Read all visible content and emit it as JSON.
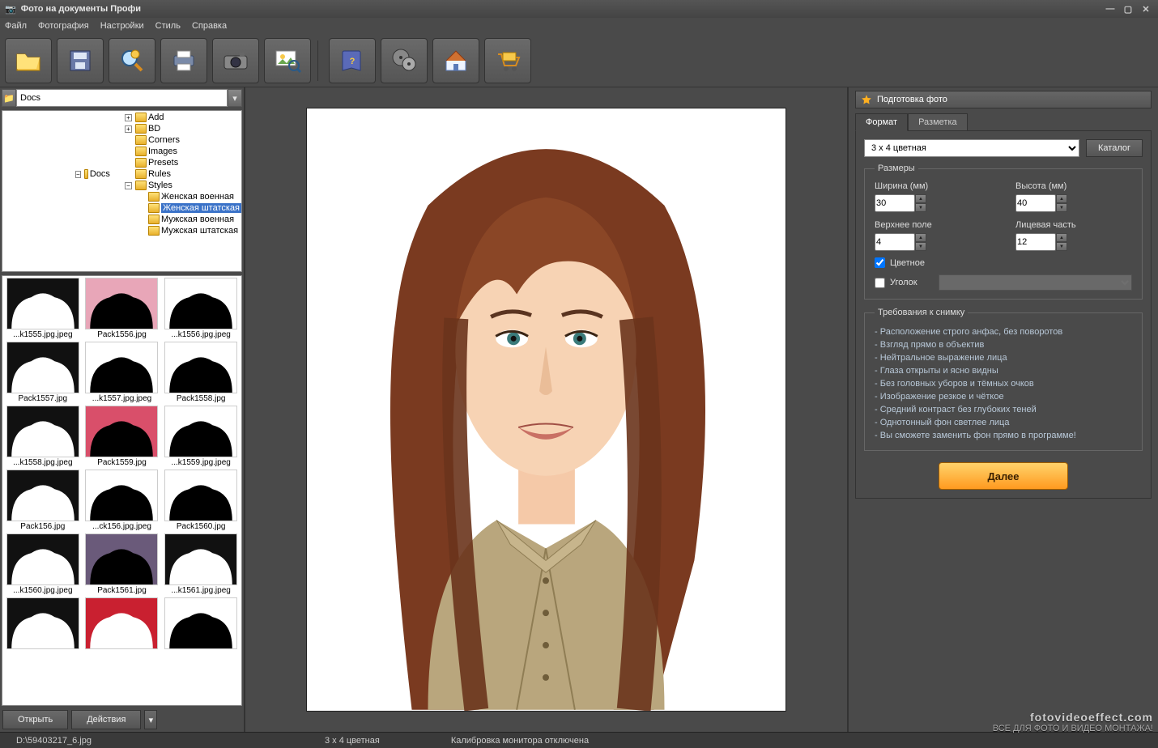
{
  "window": {
    "title": "Фото на документы Профи"
  },
  "menu": {
    "file": "Файл",
    "photo": "Фотография",
    "settings": "Настройки",
    "style": "Стиль",
    "help": "Справка"
  },
  "toolbar_icons": [
    "open",
    "save",
    "zoom",
    "print",
    "camera",
    "pictureview",
    "sep",
    "book",
    "film",
    "home",
    "cart"
  ],
  "path": {
    "value": "Docs"
  },
  "tree": {
    "root": "Docs",
    "items": [
      "Add",
      "BD",
      "Corners",
      "Images",
      "Presets",
      "Rules",
      "Styles"
    ],
    "styles_children": [
      "Женская военная",
      "Женская штатская",
      "Мужская военная",
      "Мужская штатская"
    ],
    "selected": "Женская штатская"
  },
  "thumbs": [
    "...k1555.jpg.jpeg",
    "Pack1556.jpg",
    "...k1556.jpg.jpeg",
    "Pack1557.jpg",
    "...k1557.jpg.jpeg",
    "Pack1558.jpg",
    "...k1558.jpg.jpeg",
    "Pack1559.jpg",
    "...k1559.jpg.jpeg",
    "Pack156.jpg",
    "...ck156.jpg.jpeg",
    "Pack1560.jpg",
    "...k1560.jpg.jpeg",
    "Pack1561.jpg",
    "...k1561.jpg.jpeg",
    "",
    "",
    ""
  ],
  "left_buttons": {
    "open": "Открыть",
    "actions": "Действия"
  },
  "right": {
    "title": "Подготовка фото",
    "tabs": {
      "format": "Формат",
      "layout": "Разметка"
    },
    "format_select": "3 x 4 цветная",
    "catalog": "Каталог",
    "sizes_legend": "Размеры",
    "width_label": "Ширина (мм)",
    "width": "30",
    "height_label": "Высота (мм)",
    "height": "40",
    "top_label": "Верхнее поле",
    "top": "4",
    "face_label": "Лицевая часть",
    "face": "12",
    "color_chk": "Цветное",
    "corner_chk": "Уголок",
    "req_legend": "Требования к снимку",
    "requirements": [
      "Расположение строго анфас, без поворотов",
      "Взгляд прямо в объектив",
      "Нейтральное выражение лица",
      "Глаза открыты и ясно видны",
      "Без головных уборов и тёмных очков",
      "Изображение резкое и чёткое",
      "Средний контраст без глубоких теней",
      "Однотонный фон светлее лица",
      "Вы сможете заменить фон прямо в программе!"
    ],
    "next": "Далее"
  },
  "status": {
    "path": "D:\\59403217_6.jpg",
    "format": "3 x 4 цветная",
    "calib": "Калибровка монитора отключена"
  },
  "watermark": {
    "site": "fotovideoeffect.com",
    "tag": "ВСЕ ДЛЯ ФОТО И ВИДЕО МОНТАЖА!"
  }
}
